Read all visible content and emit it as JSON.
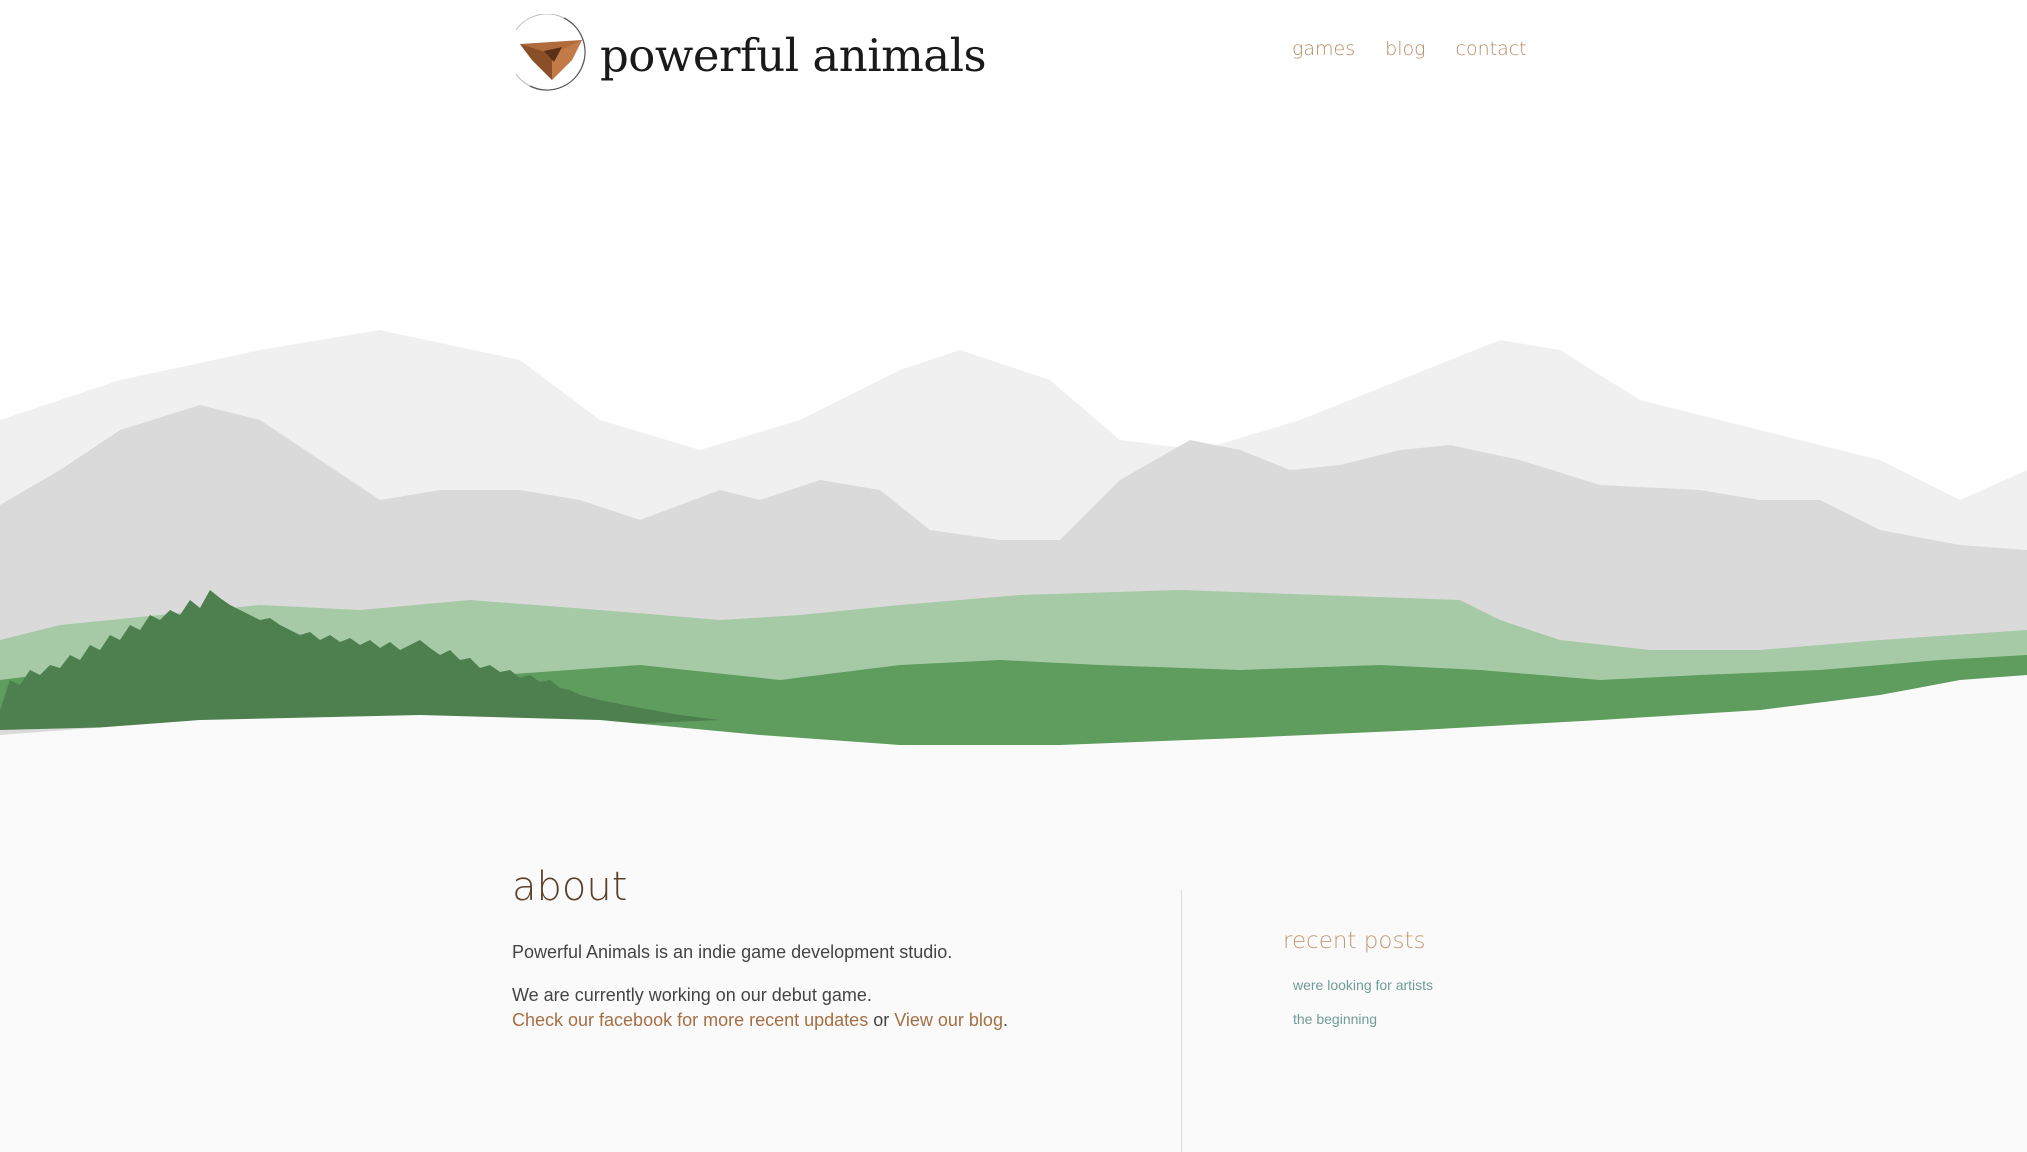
{
  "site": {
    "name": "powerful animals"
  },
  "nav": {
    "items": [
      {
        "label": "games"
      },
      {
        "label": "blog"
      },
      {
        "label": "contact"
      }
    ]
  },
  "about": {
    "title": "about",
    "intro": "Powerful Animals is an indie game development studio.",
    "working": "We are currently working on our debut game.",
    "facebook_link": "Check our facebook for more recent updates",
    "connector": " or ",
    "blog_link": "View our blog",
    "end": "."
  },
  "sidebar": {
    "title": "recent posts",
    "posts": [
      {
        "label": "were looking for artists"
      },
      {
        "label": "the beginning"
      }
    ]
  },
  "colors": {
    "nav_link": "#b58b62",
    "about_title": "#5b3f27",
    "body_link": "#a56f44",
    "sidebar_title": "#c19a74",
    "sidebar_link": "#6f9c98",
    "mountain": "#d9d9d9",
    "forest": "#4f8a4f"
  },
  "icons": {
    "logo": "fox-head-logo-icon"
  }
}
